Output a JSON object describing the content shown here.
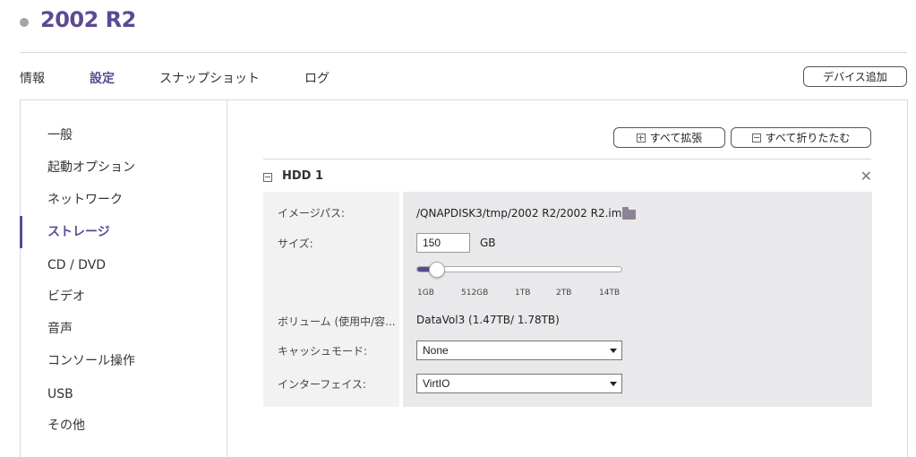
{
  "vm": {
    "name": "2002 R2",
    "status_color": "#a5a5a5"
  },
  "tabs": [
    {
      "label": "情報"
    },
    {
      "label": "設定"
    },
    {
      "label": "スナップショット"
    },
    {
      "label": "ログ"
    }
  ],
  "header": {
    "add_device_label": "デバイス追加"
  },
  "sidebar": {
    "items": [
      {
        "label": "一般"
      },
      {
        "label": "起動オプション"
      },
      {
        "label": "ネットワーク"
      },
      {
        "label": "ストレージ"
      },
      {
        "label": "CD / DVD"
      },
      {
        "label": "ビデオ"
      },
      {
        "label": "音声"
      },
      {
        "label": "コンソール操作"
      },
      {
        "label": "USB"
      },
      {
        "label": "その他"
      }
    ],
    "active_label": "ストレージ"
  },
  "content": {
    "expand_all_label": "すべて拡張",
    "collapse_all_label": "すべて折りたたむ",
    "disk": {
      "title": "HDD 1",
      "labels": {
        "image_path": "イメージパス:",
        "size": "サイズ:",
        "volume": "ボリューム (使用中/容...",
        "cache_mode": "キャッシュモード:",
        "interface": "インターフェイス:"
      },
      "image_path": "/QNAPDISK3/tmp/2002 R2/2002 R2.img",
      "size_value": "150",
      "size_unit": "GB",
      "slider_ticks": [
        "1GB",
        "512GB",
        "1TB",
        "2TB",
        "14TB"
      ],
      "slider_fraction": 0.1,
      "volume": "DataVol3 (1.47TB/ 1.78TB)",
      "cache_mode": "None",
      "interface": "VirtIO"
    }
  },
  "colors": {
    "accent": "#5b4a92",
    "divider": "#d9d9d9"
  },
  "icons": {
    "status": "status-dot-icon",
    "expand": "plus-square-icon",
    "collapse": "minus-square-icon",
    "close": "close-icon",
    "folder": "folder-icon",
    "dropdown": "chevron-down-icon"
  }
}
